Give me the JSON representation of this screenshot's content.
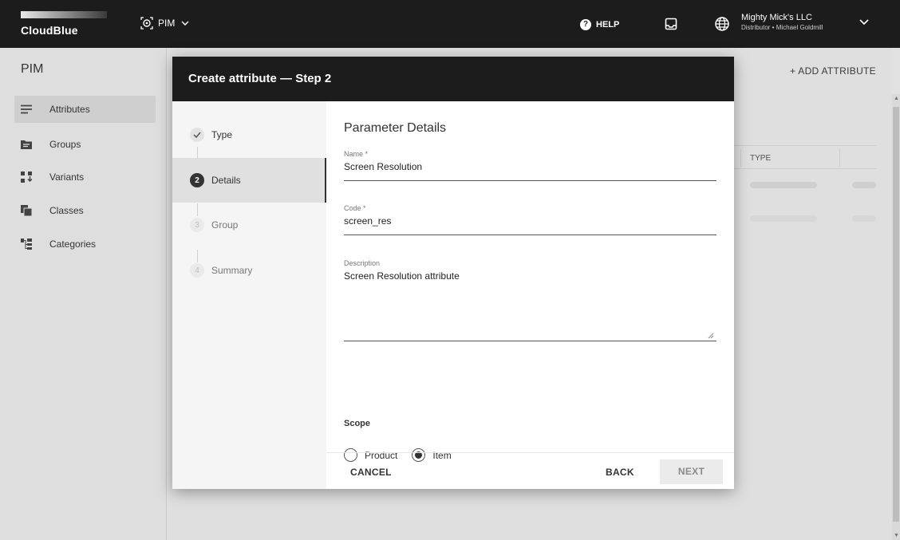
{
  "topbar": {
    "logo_text": "CloudBlue",
    "module": "PIM",
    "help": "HELP",
    "account_name": "Mighty Mick's LLC",
    "account_role": "Distributor • Michael Goldmill"
  },
  "sidebar": {
    "title": "PIM",
    "items": [
      {
        "label": "Attributes",
        "icon": "list-icon"
      },
      {
        "label": "Groups",
        "icon": "folder-icon"
      },
      {
        "label": "Variants",
        "icon": "variants-icon"
      },
      {
        "label": "Classes",
        "icon": "classes-icon"
      },
      {
        "label": "Categories",
        "icon": "categories-icon"
      }
    ]
  },
  "page": {
    "add_attribute": "+ ADD ATTRIBUTE",
    "table_col_type": "TYPE"
  },
  "dialog": {
    "title": "Create attribute — Step 2",
    "steps": [
      {
        "label": "Type",
        "badge": "✓",
        "state": "done"
      },
      {
        "label": "Details",
        "badge": "2",
        "state": "active"
      },
      {
        "label": "Group",
        "badge": "3",
        "state": "pending"
      },
      {
        "label": "Summary",
        "badge": "4",
        "state": "pending"
      }
    ],
    "section_title": "Parameter Details",
    "name": {
      "label": "Name *",
      "value": "Screen Resolution"
    },
    "code": {
      "label": "Code *",
      "value": "screen_res"
    },
    "description": {
      "label": "Description",
      "value": "Screen Resolution attribute"
    },
    "scope": {
      "title": "Scope",
      "options": [
        {
          "label": "Product",
          "selected": false
        },
        {
          "label": "Item",
          "selected": true
        }
      ]
    },
    "buttons": {
      "cancel": "CANCEL",
      "back": "BACK",
      "next": "NEXT"
    }
  },
  "colors": {
    "topbar": "#1c1c1c",
    "accent": "#333333",
    "disabled_button": "#ebebeb"
  }
}
